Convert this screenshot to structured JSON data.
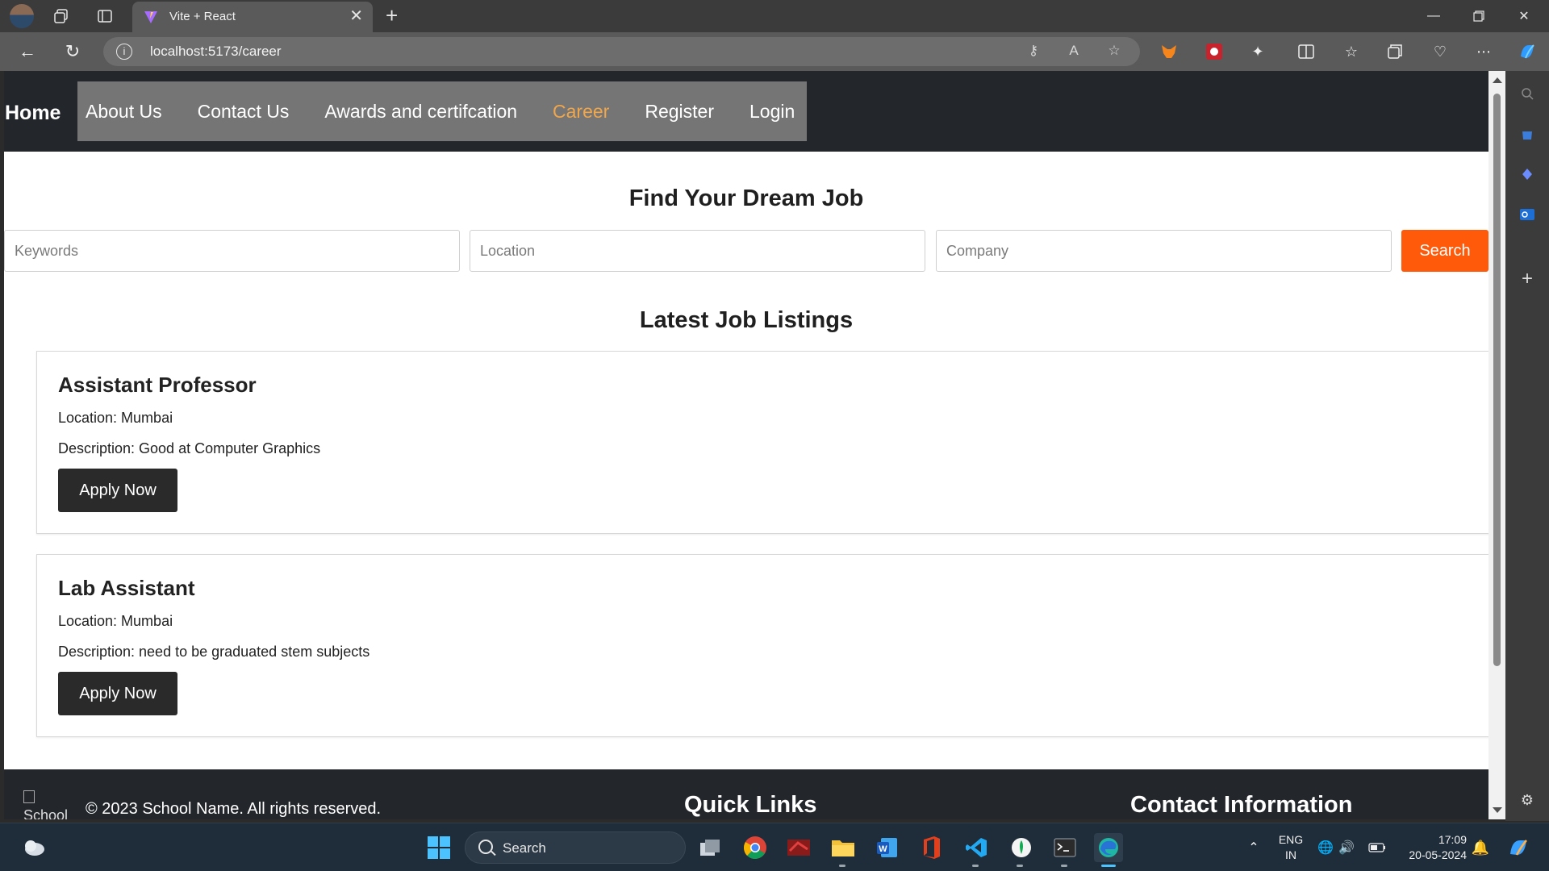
{
  "browser": {
    "tab_title": "Vite + React",
    "url": "localhost:5173/career",
    "tab_close": "✕",
    "new_tab": "+"
  },
  "site": {
    "brand": "Home",
    "menu": [
      {
        "label": "About Us",
        "active": false
      },
      {
        "label": "Contact Us",
        "active": false
      },
      {
        "label": "Awards and certifcation",
        "active": false
      },
      {
        "label": "Career",
        "active": true
      },
      {
        "label": "Register",
        "active": false
      },
      {
        "label": "Login",
        "active": false
      }
    ],
    "accent_color": "#f0a64b"
  },
  "search": {
    "heading": "Find Your Dream Job",
    "keywords_placeholder": "Keywords",
    "location_placeholder": "Location",
    "company_placeholder": "Company",
    "button_label": "Search",
    "button_color": "#ff5a0a"
  },
  "listings": {
    "heading": "Latest Job Listings",
    "jobs": [
      {
        "title": "Assistant Professor",
        "location": "Location: Mumbai",
        "description": "Description: Good at Computer Graphics",
        "apply_label": "Apply Now"
      },
      {
        "title": "Lab Assistant",
        "location": "Location: Mumbai",
        "description": "Description: need to be graduated stem subjects",
        "apply_label": "Apply Now"
      }
    ]
  },
  "footer": {
    "logo_alt": "School",
    "copyright": "© 2023 School Name. All rights reserved.",
    "quick_links_heading": "Quick Links",
    "contact_heading": "Contact Information"
  },
  "taskbar": {
    "search_label": "Search",
    "lang_line1": "ENG",
    "lang_line2": "IN",
    "time": "17:09",
    "date": "20-05-2024"
  }
}
